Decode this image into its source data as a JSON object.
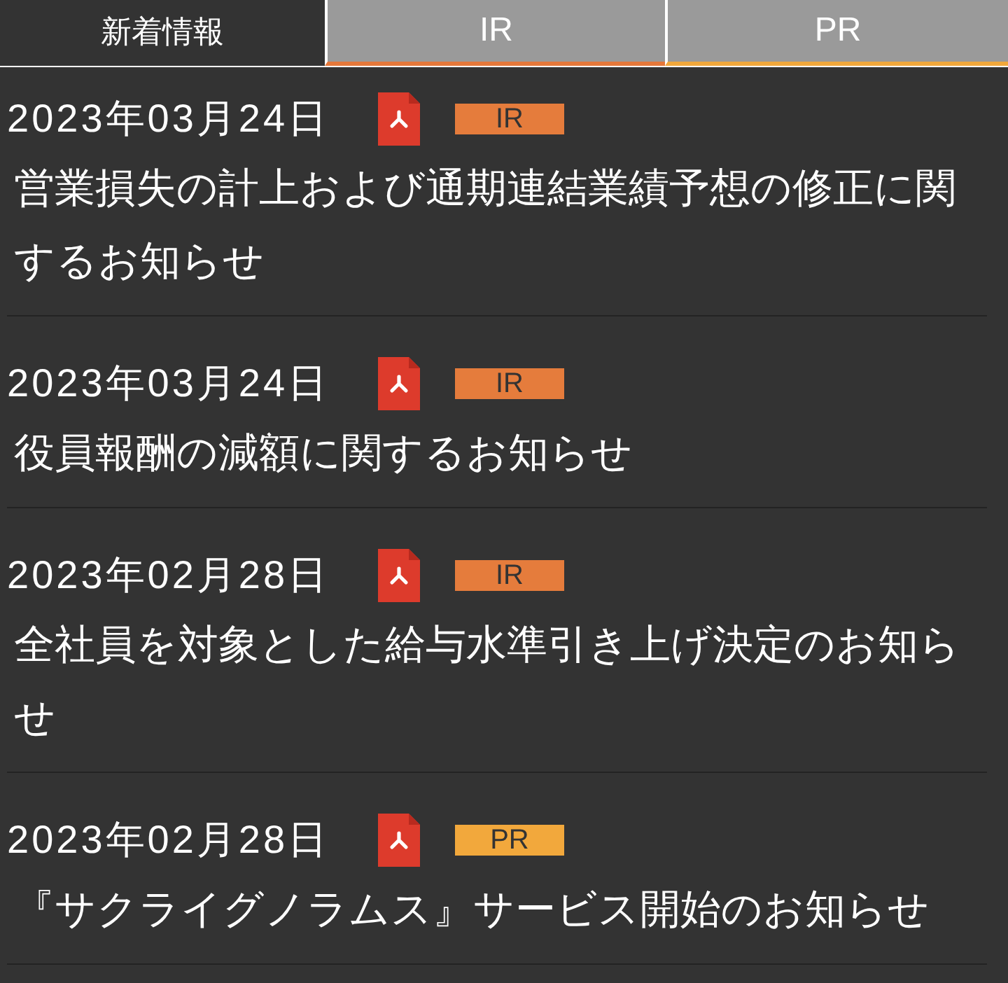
{
  "tabs": [
    {
      "label": "新着情報",
      "selected": true
    },
    {
      "label": "IR",
      "selected": false,
      "color": "#e5783a"
    },
    {
      "label": "PR",
      "selected": false,
      "color": "#f1a83c"
    }
  ],
  "news": [
    {
      "date": "2023年03月24日",
      "tag": {
        "label": "IR",
        "color": "#e57c3c"
      },
      "title": "営業損失の計上および通期連結業績予想の修正に関するお知らせ"
    },
    {
      "date": "2023年03月24日",
      "tag": {
        "label": "IR",
        "color": "#e57c3c"
      },
      "title": "役員報酬の減額に関するお知らせ"
    },
    {
      "date": "2023年02月28日",
      "tag": {
        "label": "IR",
        "color": "#e57c3c"
      },
      "title": "全社員を対象とした給与水準引き上げ決定のお知らせ"
    },
    {
      "date": "2023年02月28日",
      "tag": {
        "label": "PR",
        "color": "#f2a83c"
      },
      "title": "『サクライグノラムス』サービス開始のお知らせ"
    }
  ]
}
